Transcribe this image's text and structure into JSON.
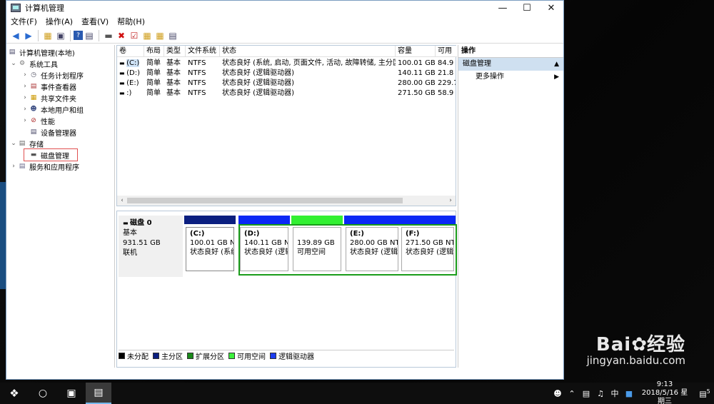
{
  "window": {
    "title": "计算机管理"
  },
  "menu": [
    "文件(F)",
    "操作(A)",
    "查看(V)",
    "帮助(H)"
  ],
  "tree": {
    "root": "计算机管理(本地)",
    "system_tools": "系统工具",
    "task_scheduler": "任务计划程序",
    "event_viewer": "事件查看器",
    "shared_folders": "共享文件夹",
    "local_users": "本地用户和组",
    "performance": "性能",
    "device_manager": "设备管理器",
    "storage": "存储",
    "disk_management": "磁盘管理",
    "services": "服务和应用程序"
  },
  "volume_list": {
    "headers": [
      "卷",
      "布局",
      "类型",
      "文件系统",
      "状态",
      "容量",
      "可用"
    ],
    "rows": [
      [
        "(C:)",
        "简单",
        "基本",
        "NTFS",
        "状态良好 (系统, 启动, 页面文件, 活动, 故障转储, 主分区)",
        "100.01 GB",
        "84.9"
      ],
      [
        "(D:)",
        "简单",
        "基本",
        "NTFS",
        "状态良好 (逻辑驱动器)",
        "140.11 GB",
        "21.8"
      ],
      [
        "(E:)",
        "简单",
        "基本",
        "NTFS",
        "状态良好 (逻辑驱动器)",
        "280.00 GB",
        "229.7"
      ],
      [
        ":)",
        "简单",
        "基本",
        "NTFS",
        "状态良好 (逻辑驱动器)",
        "271.50 GB",
        "58.9"
      ]
    ]
  },
  "disk": {
    "name": "磁盘 0",
    "type": "基本",
    "size": "931.51 GB",
    "status": "联机",
    "partitions": [
      {
        "name": "(C:)",
        "size": "100.01 GB NT",
        "status": "状态良好 (系统"
      },
      {
        "name": "(D:)",
        "size": "140.11 GB N",
        "status": "状态良好 (逻辑"
      },
      {
        "name": "",
        "size": "139.89 GB",
        "status": "可用空间"
      },
      {
        "name": "(E:)",
        "size": "280.00 GB NT",
        "status": "状态良好 (逻辑"
      },
      {
        "name": "(F:)",
        "size": "271.50 GB NT",
        "status": "状态良好 (逻辑"
      }
    ]
  },
  "legend": [
    {
      "label": "未分配",
      "color": "#000000"
    },
    {
      "label": "主分区",
      "color": "#0b1f80"
    },
    {
      "label": "扩展分区",
      "color": "#1a8a1a"
    },
    {
      "label": "可用空间",
      "color": "#3cf03c"
    },
    {
      "label": "逻辑驱动器",
      "color": "#1a3cf0"
    }
  ],
  "colors": {
    "primary": "#0b1f80",
    "logical": "#0a28f5",
    "free": "#32f032",
    "extended": "#1a9c1a"
  },
  "actions": {
    "header": "操作",
    "section": "磁盘管理",
    "more": "更多操作"
  },
  "taskbar": {
    "ime": "中",
    "time": "9:13",
    "date": "2018/5/16 星期三",
    "notifications": "5"
  },
  "watermark": {
    "brand": "Bai",
    "brand2": "经验",
    "site": "jingyan.baidu.com"
  }
}
